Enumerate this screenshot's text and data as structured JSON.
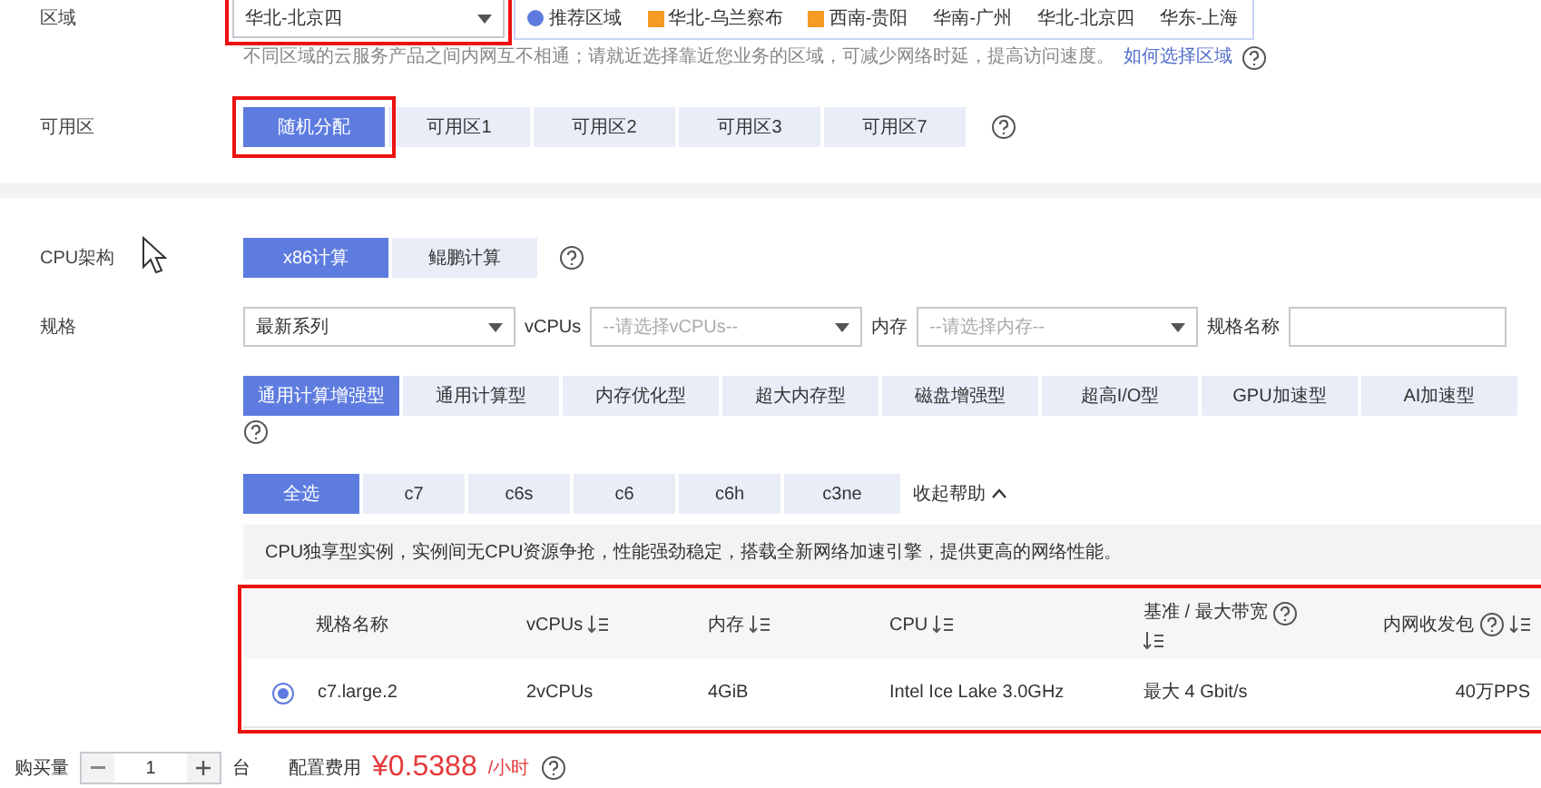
{
  "region": {
    "label": "区域",
    "select_value": "华北-北京四",
    "highlighted": true,
    "tabs": [
      {
        "label": "推荐区域",
        "selected": false,
        "kind": "recommend"
      },
      {
        "label": "华北-乌兰察布",
        "selected": false,
        "kind": "flagged"
      },
      {
        "label": "西南-贵阳",
        "selected": false,
        "kind": "flagged"
      },
      {
        "label": "华南-广州",
        "selected": false,
        "kind": "plain"
      },
      {
        "label": "华北-北京四",
        "selected": false,
        "kind": "plain"
      },
      {
        "label": "华东-上海",
        "selected": false,
        "kind": "plain"
      }
    ],
    "hint": "不同区域的云服务产品之间内网互不相通；请就近选择靠近您业务的区域，可减少网络时延，提高访问速度。",
    "hint_link": "如何选择区域"
  },
  "availability_zone": {
    "label": "可用区",
    "highlighted": true,
    "options": [
      {
        "label": "随机分配",
        "selected": true
      },
      {
        "label": "可用区1",
        "selected": false
      },
      {
        "label": "可用区2",
        "selected": false
      },
      {
        "label": "可用区3",
        "selected": false
      },
      {
        "label": "可用区7",
        "selected": false
      }
    ]
  },
  "cpu_architecture": {
    "label": "CPU架构",
    "options": [
      {
        "label": "x86计算",
        "selected": true
      },
      {
        "label": "鲲鹏计算",
        "selected": false
      }
    ]
  },
  "spec": {
    "label": "规格",
    "series_value": "最新系列",
    "vcpus_label": "vCPUs",
    "vcpus_placeholder": "--请选择vCPUs--",
    "memory_label": "内存",
    "memory_placeholder": "--请选择内存--",
    "name_label": "规格名称",
    "types": [
      {
        "label": "通用计算增强型",
        "selected": true
      },
      {
        "label": "通用计算型",
        "selected": false
      },
      {
        "label": "内存优化型",
        "selected": false
      },
      {
        "label": "超大内存型",
        "selected": false
      },
      {
        "label": "磁盘增强型",
        "selected": false
      },
      {
        "label": "超高I/O型",
        "selected": false
      },
      {
        "label": "GPU加速型",
        "selected": false
      },
      {
        "label": "AI加速型",
        "selected": false
      }
    ],
    "filters": [
      {
        "label": "全选",
        "selected": true
      },
      {
        "label": "c7",
        "selected": false
      },
      {
        "label": "c6s",
        "selected": false
      },
      {
        "label": "c6",
        "selected": false
      },
      {
        "label": "c6h",
        "selected": false
      },
      {
        "label": "c3ne",
        "selected": false
      }
    ],
    "collapse_help": "收起帮助",
    "info": "CPU独享型实例，实例间无CPU资源争抢，性能强劲稳定，搭载全新网络加速引擎，提供更高的网络性能。"
  },
  "table": {
    "highlighted": true,
    "columns": [
      {
        "label": "规格名称",
        "sortable": false,
        "help": false
      },
      {
        "label": "vCPUs",
        "sortable": true,
        "help": false
      },
      {
        "label": "内存",
        "sortable": true,
        "help": false
      },
      {
        "label": "CPU",
        "sortable": true,
        "help": false
      },
      {
        "label": "基准 / 最大带宽",
        "sortable": true,
        "help": true
      },
      {
        "label": "内网收发包",
        "sortable": true,
        "help": true
      }
    ],
    "rows": [
      {
        "selected": true,
        "cells": [
          "c7.large.2",
          "2vCPUs",
          "4GiB",
          "Intel Ice Lake 3.0GHz",
          "最大 4 Gbit/s",
          "40万PPS"
        ]
      }
    ]
  },
  "purchase": {
    "label": "购买量",
    "quantity": "1",
    "unit": "台",
    "fee_label": "配置费用",
    "price": "¥0.5388",
    "price_unit": "/小时"
  }
}
